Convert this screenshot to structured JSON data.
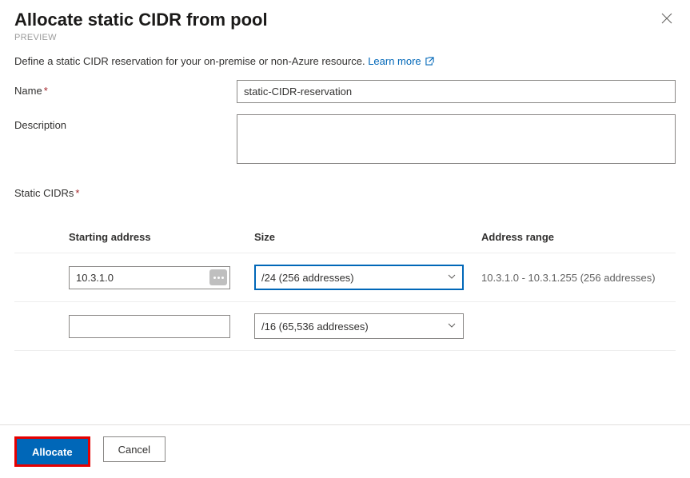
{
  "header": {
    "title": "Allocate static CIDR from pool",
    "preview_label": "PREVIEW"
  },
  "intro": {
    "text": "Define a static CIDR reservation for your on-premise or non-Azure resource. ",
    "link_label": "Learn more"
  },
  "form": {
    "name_label": "Name",
    "name_value": "static-CIDR-reservation",
    "description_label": "Description",
    "description_value": "",
    "static_cidrs_label": "Static CIDRs"
  },
  "grid": {
    "headers": {
      "starting_address": "Starting address",
      "size": "Size",
      "address_range": "Address range"
    },
    "rows": [
      {
        "starting_address": "10.3.1.0",
        "size_label": "/24 (256 addresses)",
        "address_range": "10.3.1.0 - 10.3.1.255 (256 addresses)",
        "has_ellipsis": true,
        "size_focused": true,
        "start_highlight": true
      },
      {
        "starting_address": "",
        "size_label": "/16 (65,536 addresses)",
        "address_range": "",
        "has_ellipsis": false,
        "size_focused": false,
        "start_highlight": false
      }
    ]
  },
  "footer": {
    "allocate_label": "Allocate",
    "cancel_label": "Cancel"
  }
}
